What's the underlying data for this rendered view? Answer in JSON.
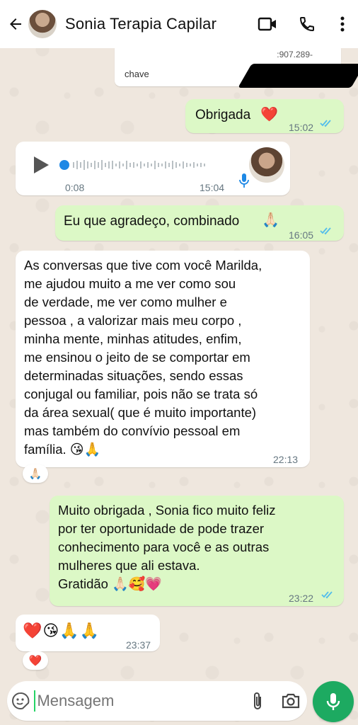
{
  "header": {
    "title": "Sonia Terapia Capilar"
  },
  "messages": {
    "attachment": {
      "label": "chave",
      "partial_number": ":907.289-"
    },
    "m1": {
      "text": "Obrigada",
      "emoji": "❤️",
      "time": "15:02"
    },
    "voice": {
      "duration": "0:08",
      "time": "15:04"
    },
    "m2": {
      "text": "Eu que agradeço, combinado",
      "emoji": "🙏🏻",
      "time": "16:05"
    },
    "m3": {
      "lines": [
        "As conversas que tive com você Marilda,",
        "me ajudou muito a me ver como sou",
        "de verdade, me ver como mulher e",
        "pessoa , a valorizar mais meu corpo ,",
        "minha mente,  minhas atitudes, enfim,",
        "me ensinou o jeito de se comportar em",
        "determinadas situações, sendo essas",
        "conjugal ou familiar, pois não se trata só",
        "da área sexual( que é muito importante)",
        "mas também do convívio pessoal em",
        "família."
      ],
      "emoji": "😘🙏",
      "time": "22:13",
      "reaction": "🙏🏻"
    },
    "m4": {
      "lines": [
        "Muito obrigada , Sonia  fico muito feliz",
        "por ter oportunidade de pode trazer",
        "conhecimento para você  e as outras",
        "mulheres que ali estava.",
        "Gratidão"
      ],
      "emoji": "🙏🏻🥰💗",
      "time": "23:22"
    },
    "m5": {
      "emoji": "❤️😘🙏🙏",
      "time": "23:37",
      "reaction": "❤️"
    }
  },
  "composer": {
    "placeholder": "Mensagem"
  },
  "colors": {
    "outgoing": "#dcf8c6",
    "incoming": "#ffffff",
    "tick": "#53bdeb",
    "accent": "#1daa61"
  },
  "icons": [
    "back-arrow-icon",
    "video-call-icon",
    "phone-icon",
    "more-vert-icon",
    "play-icon",
    "mic-icon",
    "sticker-icon",
    "attach-icon",
    "camera-icon",
    "double-check-icon"
  ]
}
